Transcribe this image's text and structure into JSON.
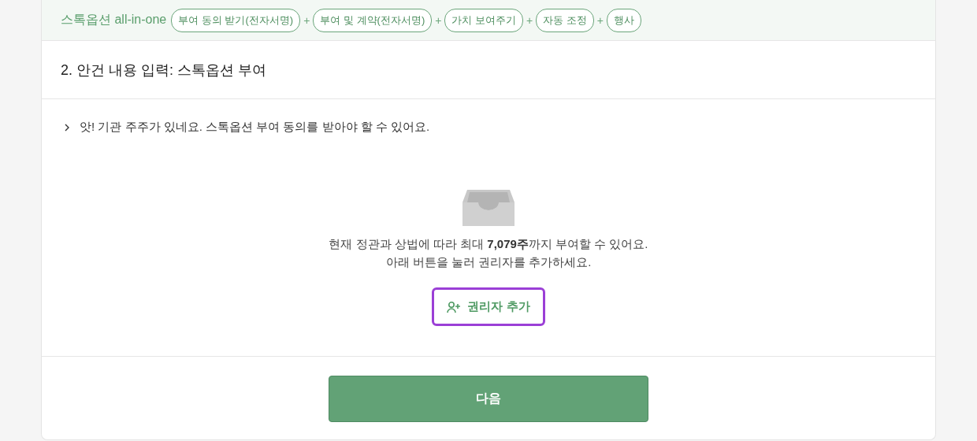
{
  "header": {
    "title": "스톡옵션 all-in-one",
    "flow": [
      {
        "kind": "step",
        "label": "부여 동의 받기(전자서명)"
      },
      {
        "kind": "plus",
        "label": "+"
      },
      {
        "kind": "step",
        "label": "부여 및 계약(전자서명)"
      },
      {
        "kind": "plus",
        "label": "+"
      },
      {
        "kind": "step",
        "label": "가치 보여주기"
      },
      {
        "kind": "plus",
        "label": "+"
      },
      {
        "kind": "step",
        "label": "자동 조정"
      },
      {
        "kind": "plus",
        "label": "+"
      },
      {
        "kind": "step",
        "label": "행사"
      }
    ]
  },
  "section_title": "2. 안건 내용 입력: 스톡옵션 부여",
  "notice": {
    "text": "앗! 기관 주주가 있네요. 스톡옵션 부여 동의를 받아야 할 수 있어요.",
    "expanded": false
  },
  "empty_state": {
    "lines": [
      "현재 정관과 상법에 따라 최대 **7,079주**까지 부여할 수 있어요.",
      "아래 버튼을 눌러 권리자를 추가하세요."
    ],
    "add_button": "권리자 추가"
  },
  "next_button": "다음"
}
